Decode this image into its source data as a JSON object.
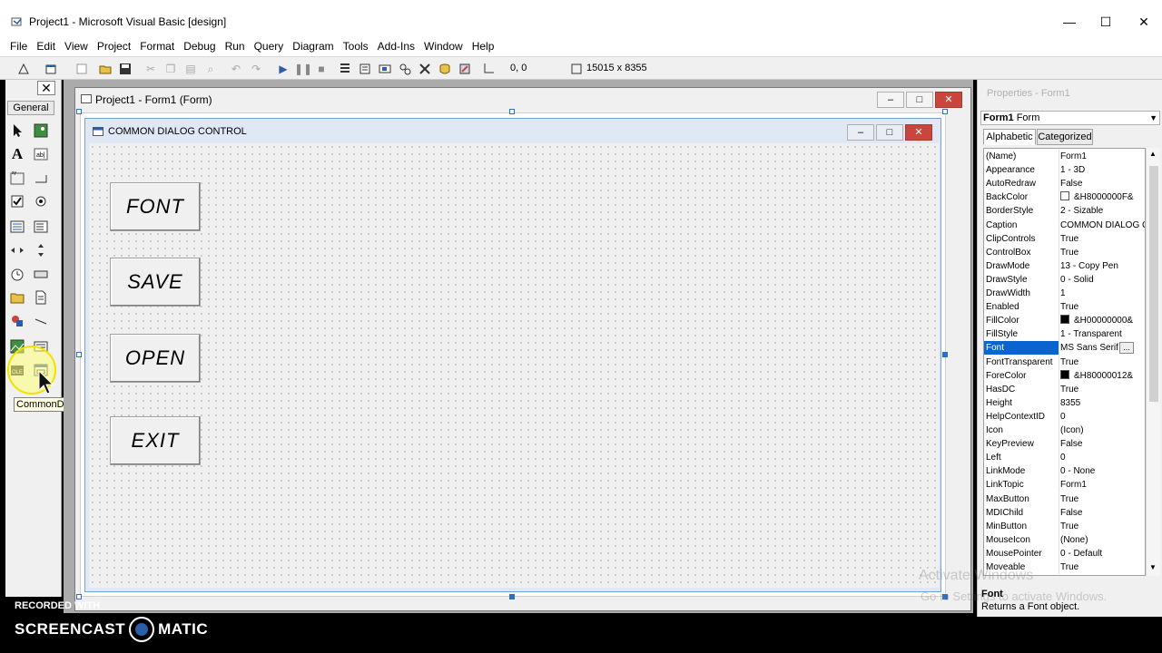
{
  "window": {
    "title": "Project1 - Microsoft Visual Basic [design]",
    "minimize": "—",
    "maximize": "☐",
    "close": "✕"
  },
  "menu": [
    "File",
    "Edit",
    "View",
    "Project",
    "Format",
    "Debug",
    "Run",
    "Query",
    "Diagram",
    "Tools",
    "Add-Ins",
    "Window",
    "Help"
  ],
  "toolbar": {
    "position": "0, 0",
    "size": "15015 x 8355"
  },
  "toolbox": {
    "close": "✕",
    "tab": "General",
    "tooltip": "CommonDialog",
    "tools": [
      "pointer-icon",
      "picturebox-icon",
      "label-icon",
      "textbox-icon",
      "frame-icon",
      "commandbutton-icon",
      "checkbox-icon",
      "optionbutton-icon",
      "combobox-icon",
      "listbox-icon",
      "hscrollbar-icon",
      "vscrollbar-icon",
      "timer-icon",
      "drivelistbox-icon",
      "dirlistbox-icon",
      "filelistbox-icon",
      "shape-icon",
      "line-icon",
      "image-icon",
      "data-icon",
      "ole-icon",
      "commondialog-icon"
    ]
  },
  "form_window": {
    "title": "Project1 - Form1 (Form)"
  },
  "form": {
    "caption": "COMMON DIALOG CONTROL",
    "buttons": [
      "FONT",
      "SAVE",
      "OPEN",
      "EXIT"
    ]
  },
  "properties": {
    "title": "Properties - Form1",
    "object": "Form1",
    "object_type": "Form",
    "tabs": [
      "Alphabetic",
      "Categorized"
    ],
    "selected_property": "Font",
    "rows": [
      {
        "name": "(Name)",
        "value": "Form1"
      },
      {
        "name": "Appearance",
        "value": "1 - 3D"
      },
      {
        "name": "AutoRedraw",
        "value": "False"
      },
      {
        "name": "BackColor",
        "value": "&H8000000F&",
        "swatch": "#ffffff"
      },
      {
        "name": "BorderStyle",
        "value": "2 - Sizable"
      },
      {
        "name": "Caption",
        "value": "COMMON DIALOG C"
      },
      {
        "name": "ClipControls",
        "value": "True"
      },
      {
        "name": "ControlBox",
        "value": "True"
      },
      {
        "name": "DrawMode",
        "value": "13 - Copy Pen"
      },
      {
        "name": "DrawStyle",
        "value": "0 - Solid"
      },
      {
        "name": "DrawWidth",
        "value": "1"
      },
      {
        "name": "Enabled",
        "value": "True"
      },
      {
        "name": "FillColor",
        "value": "&H00000000&",
        "swatch": "#000000"
      },
      {
        "name": "FillStyle",
        "value": "1 - Transparent"
      },
      {
        "name": "Font",
        "value": "MS Sans Serif"
      },
      {
        "name": "FontTransparent",
        "value": "True"
      },
      {
        "name": "ForeColor",
        "value": "&H80000012&",
        "swatch": "#000000"
      },
      {
        "name": "HasDC",
        "value": "True"
      },
      {
        "name": "Height",
        "value": "8355"
      },
      {
        "name": "HelpContextID",
        "value": "0"
      },
      {
        "name": "Icon",
        "value": "(Icon)"
      },
      {
        "name": "KeyPreview",
        "value": "False"
      },
      {
        "name": "Left",
        "value": "0"
      },
      {
        "name": "LinkMode",
        "value": "0 - None"
      },
      {
        "name": "LinkTopic",
        "value": "Form1"
      },
      {
        "name": "MaxButton",
        "value": "True"
      },
      {
        "name": "MDIChild",
        "value": "False"
      },
      {
        "name": "MinButton",
        "value": "True"
      },
      {
        "name": "MouseIcon",
        "value": "(None)"
      },
      {
        "name": "MousePointer",
        "value": "0 - Default"
      },
      {
        "name": "Moveable",
        "value": "True"
      }
    ],
    "description_title": "Font",
    "description": "Returns a Font object."
  },
  "watermark": {
    "line1": "Activate Windows",
    "line2": "Go to Settings to activate Windows."
  },
  "recorder": {
    "label": "RECORDED WITH",
    "brand_left": "SCREENCAST",
    "brand_right": "MATIC"
  },
  "colors": {
    "selection": "#0a64d0",
    "close_button": "#c9463d",
    "handle": "#2f6fbf"
  }
}
